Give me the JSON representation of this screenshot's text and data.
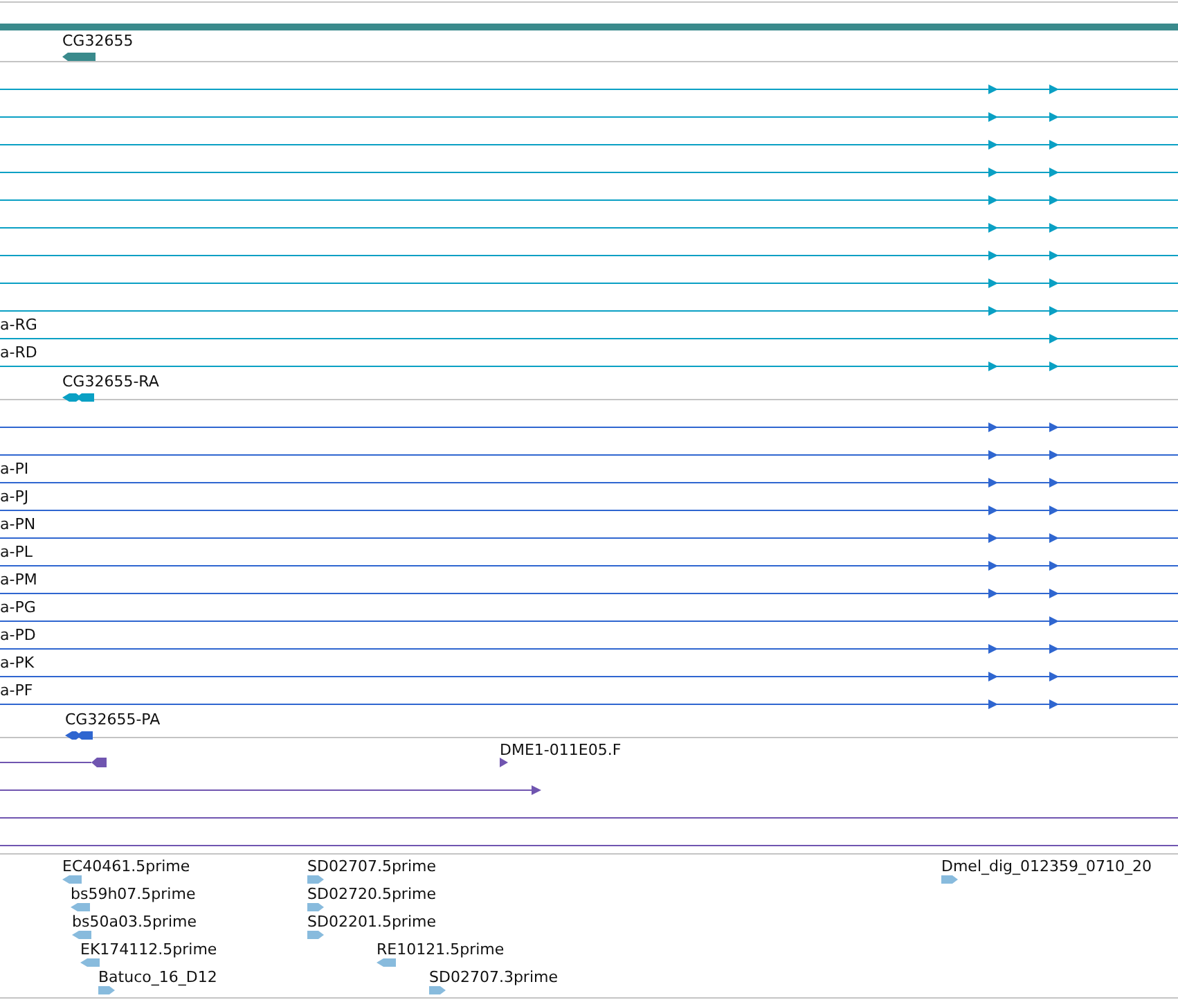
{
  "gene_track": {
    "label": "CG32655"
  },
  "transcript_track": {
    "rows": [
      {
        "first_arrow": true
      },
      {
        "first_arrow": true
      },
      {
        "first_arrow": true
      },
      {
        "first_arrow": true
      },
      {
        "first_arrow": true
      },
      {
        "first_arrow": true
      },
      {
        "first_arrow": true
      },
      {
        "first_arrow": true
      },
      {
        "first_arrow": true
      },
      {
        "label": "a-RG",
        "first_arrow": false
      },
      {
        "label": "a-RD",
        "first_arrow": true
      }
    ],
    "feature_label": "CG32655-RA"
  },
  "protein_track": {
    "rows": [
      {
        "first_arrow": true
      },
      {
        "first_arrow": true
      },
      {
        "label": "a-PI",
        "first_arrow": true
      },
      {
        "label": "a-PJ",
        "first_arrow": true
      },
      {
        "label": "a-PN",
        "first_arrow": true
      },
      {
        "label": "a-PL",
        "first_arrow": true
      },
      {
        "label": "a-PM",
        "first_arrow": true
      },
      {
        "label": "a-PG",
        "first_arrow": false
      },
      {
        "label": "a-PD",
        "first_arrow": true
      },
      {
        "label": "a-PK",
        "first_arrow": true
      },
      {
        "label": "a-PF",
        "first_arrow": true
      }
    ],
    "feature_label": "CG32655-PA"
  },
  "clone_track": {
    "label": "DME1-011E05.F"
  },
  "est_track": {
    "items": [
      {
        "label": "EC40461.5prime",
        "reverse": true
      },
      {
        "label": "bs59h07.5prime",
        "reverse": true
      },
      {
        "label": "bs50a03.5prime",
        "reverse": true
      },
      {
        "label": "EK174112.5prime",
        "reverse": true
      },
      {
        "label": "Batuco_16_D12",
        "reverse": false
      },
      {
        "label": "SD02707.5prime",
        "reverse": false
      },
      {
        "label": "SD02720.5prime",
        "reverse": false
      },
      {
        "label": "SD02201.5prime",
        "reverse": false
      },
      {
        "label": "RE10121.5prime",
        "reverse": true
      },
      {
        "label": "SD02707.3prime",
        "reverse": false
      },
      {
        "label": "Dmel_dig_012359_0710_20",
        "reverse": false
      }
    ]
  }
}
